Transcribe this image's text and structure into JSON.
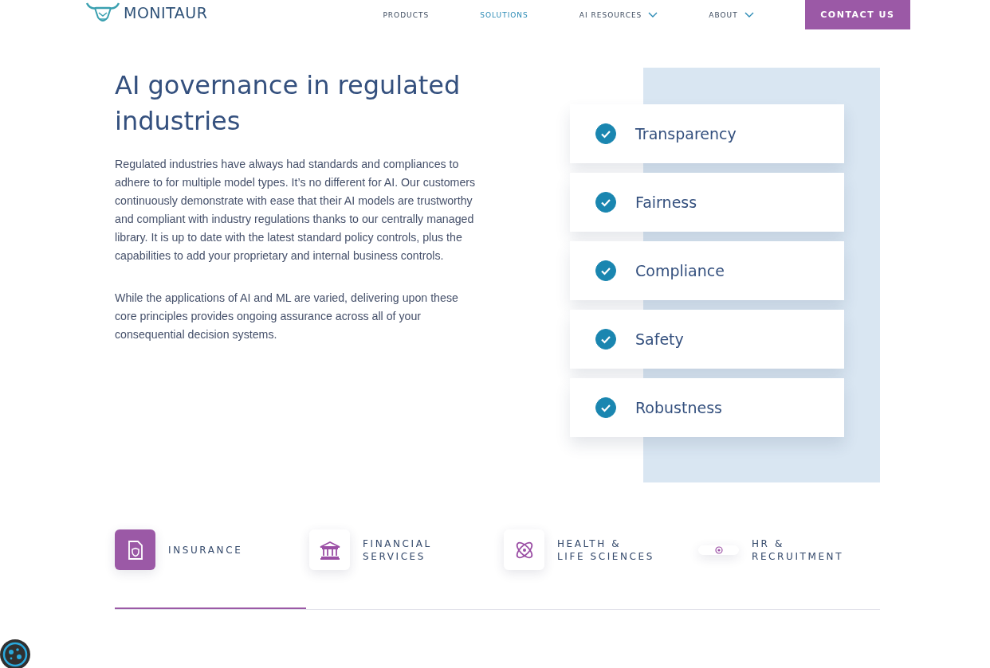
{
  "header": {
    "logo_text": "MONITAUR",
    "nav": [
      {
        "label": "PRODUCTS",
        "selected": false,
        "dropdown": false
      },
      {
        "label": "SOLUTIONS",
        "selected": true,
        "dropdown": false
      },
      {
        "label": "AI RESOURCES",
        "selected": false,
        "dropdown": true
      },
      {
        "label": "ABOUT",
        "selected": false,
        "dropdown": true
      }
    ],
    "cta": "CONTACT US"
  },
  "intro": {
    "title": "AI governance in regulated industries",
    "paragraphs": [
      "Regulated industries have always had standards and compliances to adhere to for multiple model types. It’s no different for AI. Our customers continuously demonstrate with ease that their AI models are trustworthy and compliant with industry regulations thanks to our centrally managed library. It is up to date with the latest standard policy controls, plus the capabilities to add your proprietary and internal business controls.",
      "While the applications of AI and ML are varied, delivering upon these core principles provides ongoing assurance across all of your consequential decision systems."
    ]
  },
  "principles": [
    {
      "label": "Transparency",
      "checked": true
    },
    {
      "label": "Fairness",
      "checked": true
    },
    {
      "label": "Compliance",
      "checked": true
    },
    {
      "label": "Safety",
      "checked": true
    },
    {
      "label": "Robustness",
      "checked": true
    }
  ],
  "industry_tabs": [
    {
      "lines": [
        "INSURANCE"
      ],
      "selected": true
    },
    {
      "lines": [
        "FINANCIAL",
        "SERVICES"
      ],
      "selected": false
    },
    {
      "lines": [
        "HEALTH &",
        "LIFE SCIENCES"
      ],
      "selected": false
    },
    {
      "lines": [
        "HR &",
        "RECRUITMENT"
      ],
      "selected": false
    }
  ]
}
